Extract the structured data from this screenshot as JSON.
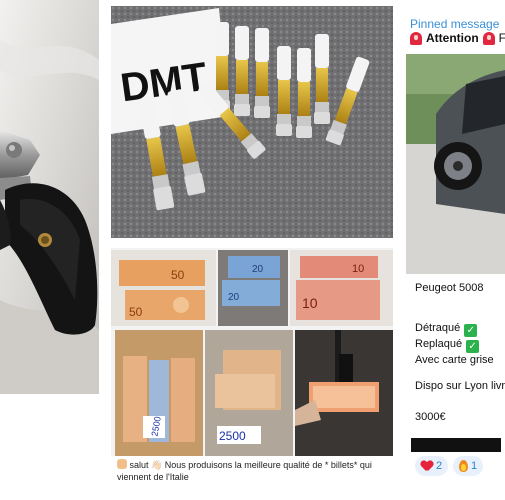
{
  "top_center_photo": {
    "sign_text": "DMT"
  },
  "bills_grid": {
    "labels": [
      "50",
      "50",
      "20",
      "20",
      "10",
      "10"
    ],
    "handwritten": [
      "2500",
      "2500"
    ],
    "caption": "salut 👋🏻 Nous produisons la meilleure qualité de * billets* qui viennent de l'Italie"
  },
  "telegram": {
    "pinned_title": "Pinned message",
    "pinned_text": "Attention",
    "pinned_trailing": "F",
    "car_model": "Peugeot 5008",
    "detraque": "Détraqué",
    "replaque": "Replaqué",
    "carte_grise": "Avec carte grise",
    "dispo": "Dispo sur Lyon livr",
    "price": "3000€",
    "reaction_heart_count": "2",
    "reaction_fire_count": "1",
    "icons": [
      "siren-icon",
      "check-icon",
      "heart-icon",
      "fire-icon"
    ],
    "colors": {
      "link": "#3a8fd8",
      "check": "#2bb24c",
      "siren": "#e0283e"
    }
  }
}
